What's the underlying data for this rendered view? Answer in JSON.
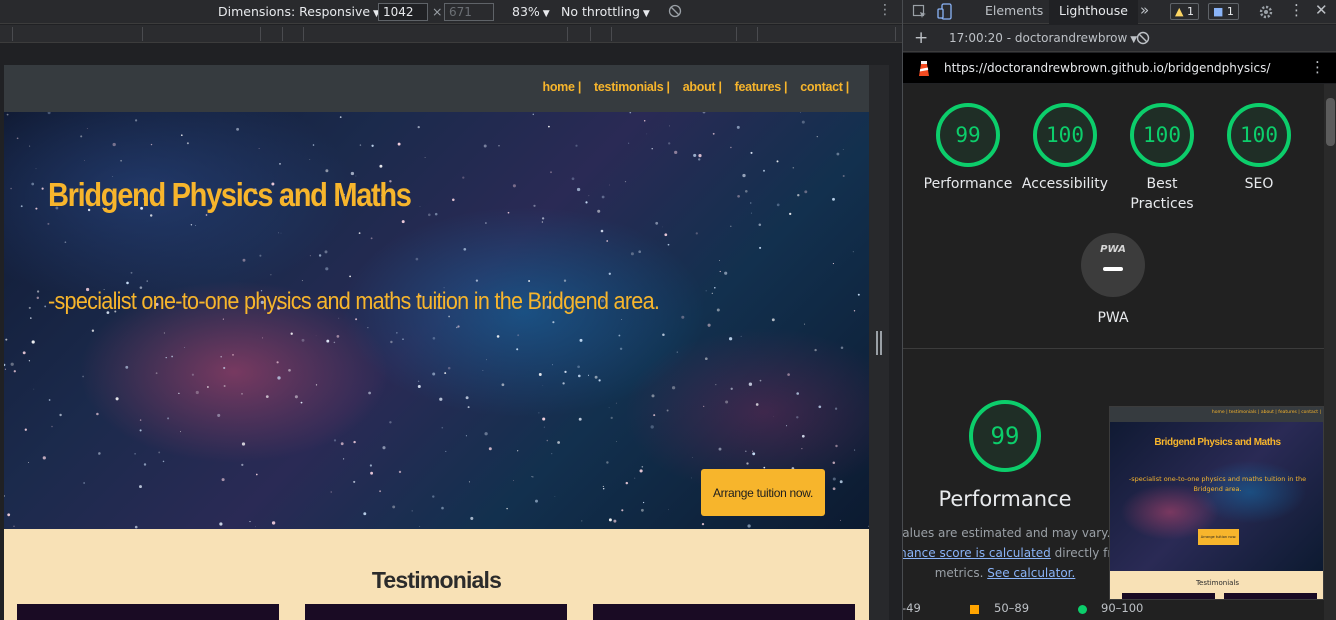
{
  "device_toolbar": {
    "dimensions_label": "Dimensions: Responsive",
    "width": "1042",
    "height_placeholder": "671",
    "times": "×",
    "zoom": "83%",
    "throttling": "No throttling"
  },
  "site": {
    "nav": [
      "home |",
      "testimonials |",
      "about |",
      "features |",
      "contact |"
    ],
    "title": "Bridgend Physics and Maths",
    "tagline": "-specialist one-to-one physics and maths tuition in the Bridgend area.",
    "cta": "Arrange tuition now.",
    "testimonials_heading": "Testimonials"
  },
  "devtools": {
    "tabs": [
      "Elements",
      "Lighthouse"
    ],
    "active_tab": "Lighthouse",
    "warnings_count": "1",
    "messages_count": "1",
    "report_label": "17:00:20 - doctorandrewbrow",
    "url": "https://doctorandrewbrown.github.io/bridgendphysics/"
  },
  "lighthouse": {
    "scores": [
      {
        "label": "Performance",
        "value": "99"
      },
      {
        "label": "Accessibility",
        "value": "100"
      },
      {
        "label": "Best Practices",
        "value": "100"
      },
      {
        "label": "SEO",
        "value": "100"
      }
    ],
    "pwa_badge": "PWA",
    "pwa_label": "PWA",
    "performance_score": "99",
    "performance_title": "Performance",
    "desc_line1": "Values are estimated and may vary. The",
    "desc_link1": "mance score is calculated",
    "desc_line2_rest": "directly from t",
    "desc_line3": "metrics.",
    "desc_link2": "See calculator.",
    "legend": [
      "-49",
      "50–89",
      "90–100"
    ],
    "colors": {
      "pass": "#0cce6b",
      "average": "#ffa400",
      "fail": "#ff4e42"
    }
  },
  "thumbnail": {
    "nav": "home |   testimonials |   about |   features |   contact |",
    "title": "Bridgend Physics and Maths",
    "tagline": "-specialist one-to-one physics and maths tuition in the Bridgend area.",
    "cta": "Arrange tuition now.",
    "heading": "Testimonials"
  }
}
